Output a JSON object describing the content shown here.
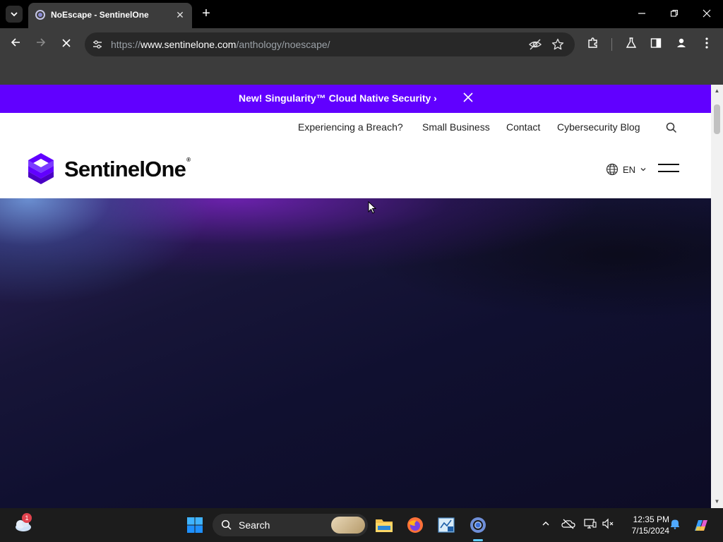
{
  "browser": {
    "tab_title": "NoEscape - SentinelOne",
    "url_prefix": "https://",
    "url_host": "www.sentinelone.com",
    "url_path": "/anthology/noescape/"
  },
  "page": {
    "promo_text": "New! Singularity™ Cloud Native Security",
    "promo_chevron": "›",
    "util_nav": {
      "breach": "Experiencing a Breach?",
      "small_business": "Small Business",
      "contact": "Contact",
      "blog": "Cybersecurity Blog"
    },
    "logo_text": "SentinelOne",
    "logo_tm": "®",
    "language": "EN",
    "brand_color": "#6100ff"
  },
  "taskbar": {
    "weather_badge": "1",
    "search_label": "Search",
    "time": "12:35 PM",
    "date": "7/15/2024"
  }
}
